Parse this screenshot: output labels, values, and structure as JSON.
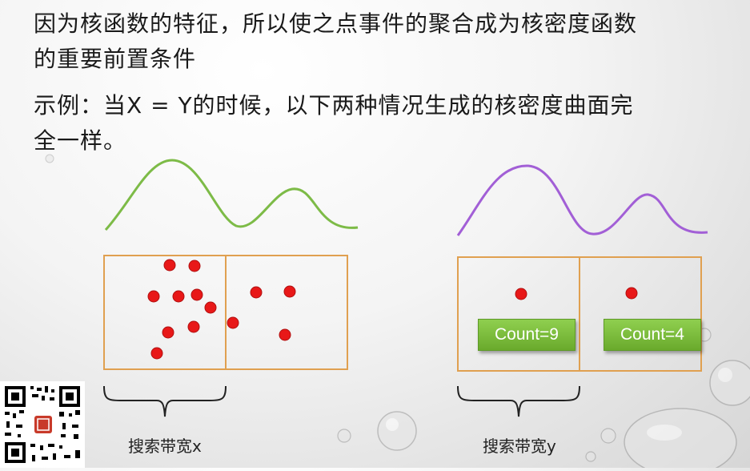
{
  "text": {
    "line1": "因为核函数的特征，所以使之点事件的聚合成为核密度函数",
    "line2": "的重要前置条件",
    "line3": "示例：当X = Y的时候，以下两种情况生成的核密度曲面完",
    "line4": "全一样。"
  },
  "left_panel": {
    "curve_color": "#7dbb47",
    "bandwidth_label": "搜索带宽x"
  },
  "right_panel": {
    "curve_color": "#a25fd6",
    "bandwidth_label": "搜索带宽y",
    "count_left": "Count=9",
    "count_right": "Count=4"
  },
  "colors": {
    "box_border": "#e0a050",
    "point": "#e81818",
    "count_bg": "#7dbf3e"
  },
  "icons": {
    "qr": "qr-code-icon"
  }
}
